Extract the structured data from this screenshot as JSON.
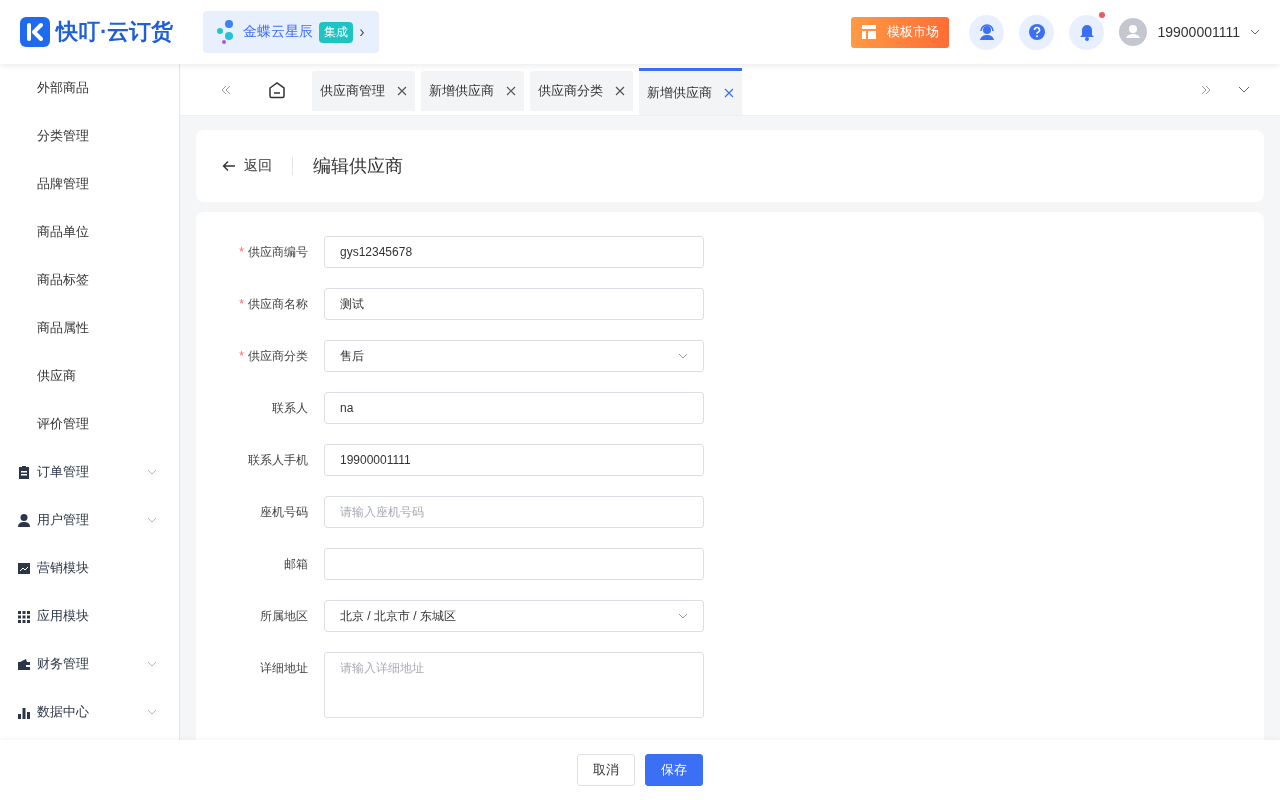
{
  "header": {
    "logo": "快叮·云订货",
    "promo": {
      "label": "金蝶云星辰",
      "badge": "集成",
      "arrow": "›"
    },
    "market_button": "模板市场",
    "notification_dot": true,
    "user": "19900001111"
  },
  "sidebar": {
    "items": [
      {
        "label": "外部商品",
        "kind": "child"
      },
      {
        "label": "分类管理",
        "kind": "child"
      },
      {
        "label": "品牌管理",
        "kind": "child"
      },
      {
        "label": "商品单位",
        "kind": "child"
      },
      {
        "label": "商品标签",
        "kind": "child"
      },
      {
        "label": "商品属性",
        "kind": "child"
      },
      {
        "label": "供应商",
        "kind": "child"
      },
      {
        "label": "评价管理",
        "kind": "child"
      },
      {
        "label": "订单管理",
        "kind": "group",
        "expandable": true
      },
      {
        "label": "用户管理",
        "kind": "group",
        "expandable": true
      },
      {
        "label": "营销模块",
        "kind": "group",
        "expandable": false
      },
      {
        "label": "应用模块",
        "kind": "group",
        "expandable": false
      },
      {
        "label": "财务管理",
        "kind": "group",
        "expandable": true
      },
      {
        "label": "数据中心",
        "kind": "group",
        "expandable": true
      }
    ]
  },
  "tabs": [
    {
      "label": "供应商管理",
      "selected": false
    },
    {
      "label": "新增供应商",
      "selected": false
    },
    {
      "label": "供应商分类",
      "selected": false
    },
    {
      "label": "新增供应商",
      "selected": true
    }
  ],
  "page": {
    "back": "返回",
    "title": "编辑供应商"
  },
  "form": [
    {
      "label": "供应商编号",
      "asterisk": "*",
      "kind": "input",
      "value": "gys12345678"
    },
    {
      "label": "供应商名称",
      "asterisk": "*",
      "kind": "input",
      "value": "测试"
    },
    {
      "label": "供应商分类",
      "asterisk": "*",
      "kind": "select",
      "value": "售后"
    },
    {
      "label": "联系人",
      "kind": "input",
      "value": "na"
    },
    {
      "label": "联系人手机",
      "kind": "input",
      "value": "19900001111"
    },
    {
      "label": "座机号码",
      "kind": "input",
      "placeholder": "请输入座机号码"
    },
    {
      "label": "邮箱",
      "kind": "input"
    },
    {
      "label": "所属地区",
      "kind": "select",
      "value": "北京 / 北京市 / 东城区"
    },
    {
      "label": "详细地址",
      "kind": "textarea",
      "placeholder": "请输入详细地址"
    }
  ],
  "footer": {
    "cancel": "取消",
    "save": "保存"
  }
}
